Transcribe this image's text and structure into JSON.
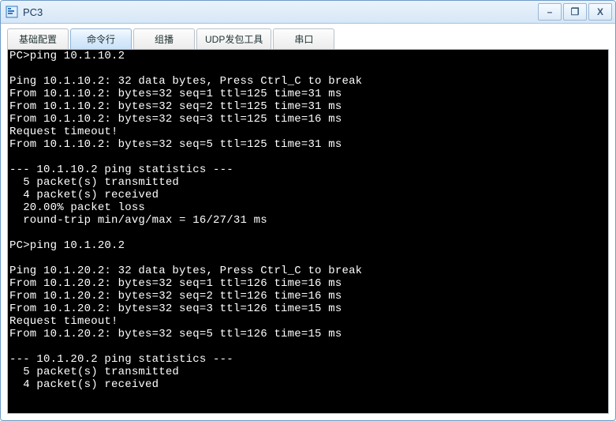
{
  "window": {
    "title": "PC3"
  },
  "win_buttons": {
    "minimize": "–",
    "maximize": "❐",
    "close": "X"
  },
  "tabs": [
    {
      "label": "基础配置",
      "active": false
    },
    {
      "label": "命令行",
      "active": true
    },
    {
      "label": "组播",
      "active": false
    },
    {
      "label": "UDP发包工具",
      "active": false
    },
    {
      "label": "串口",
      "active": false
    }
  ],
  "terminal_lines": [
    "PC>ping 10.1.10.2",
    "",
    "Ping 10.1.10.2: 32 data bytes, Press Ctrl_C to break",
    "From 10.1.10.2: bytes=32 seq=1 ttl=125 time=31 ms",
    "From 10.1.10.2: bytes=32 seq=2 ttl=125 time=31 ms",
    "From 10.1.10.2: bytes=32 seq=3 ttl=125 time=16 ms",
    "Request timeout!",
    "From 10.1.10.2: bytes=32 seq=5 ttl=125 time=31 ms",
    "",
    "--- 10.1.10.2 ping statistics ---",
    "  5 packet(s) transmitted",
    "  4 packet(s) received",
    "  20.00% packet loss",
    "  round-trip min/avg/max = 16/27/31 ms",
    "",
    "PC>ping 10.1.20.2",
    "",
    "Ping 10.1.20.2: 32 data bytes, Press Ctrl_C to break",
    "From 10.1.20.2: bytes=32 seq=1 ttl=126 time=16 ms",
    "From 10.1.20.2: bytes=32 seq=2 ttl=126 time=16 ms",
    "From 10.1.20.2: bytes=32 seq=3 ttl=126 time=15 ms",
    "Request timeout!",
    "From 10.1.20.2: bytes=32 seq=5 ttl=126 time=15 ms",
    "",
    "--- 10.1.20.2 ping statistics ---",
    "  5 packet(s) transmitted",
    "  4 packet(s) received"
  ]
}
